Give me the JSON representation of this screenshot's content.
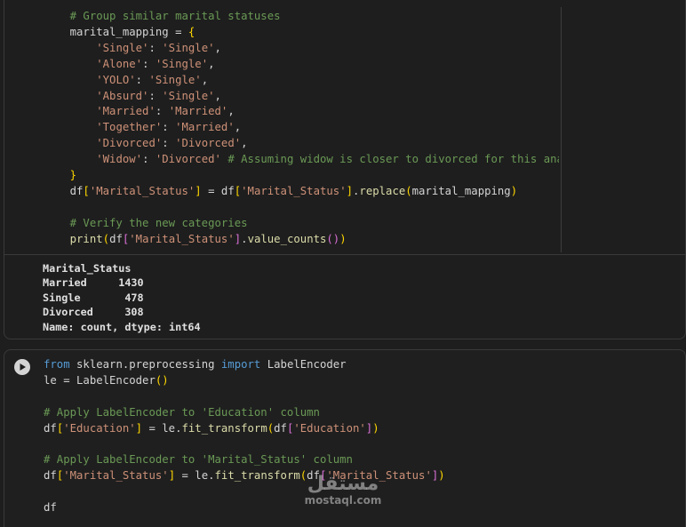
{
  "cell1": {
    "lines": [
      [
        {
          "t": "    # Group similar marital statuses",
          "c": "cm"
        }
      ],
      [
        {
          "t": "    marital_mapping = "
        },
        {
          "t": "{",
          "c": "br"
        }
      ],
      [
        {
          "t": "        "
        },
        {
          "t": "'Single'",
          "c": "st"
        },
        {
          "t": ": "
        },
        {
          "t": "'Single'",
          "c": "st"
        },
        {
          "t": ","
        }
      ],
      [
        {
          "t": "        "
        },
        {
          "t": "'Alone'",
          "c": "st"
        },
        {
          "t": ": "
        },
        {
          "t": "'Single'",
          "c": "st"
        },
        {
          "t": ","
        }
      ],
      [
        {
          "t": "        "
        },
        {
          "t": "'YOLO'",
          "c": "st"
        },
        {
          "t": ": "
        },
        {
          "t": "'Single'",
          "c": "st"
        },
        {
          "t": ","
        }
      ],
      [
        {
          "t": "        "
        },
        {
          "t": "'Absurd'",
          "c": "st"
        },
        {
          "t": ": "
        },
        {
          "t": "'Single'",
          "c": "st"
        },
        {
          "t": ","
        }
      ],
      [
        {
          "t": "        "
        },
        {
          "t": "'Married'",
          "c": "st"
        },
        {
          "t": ": "
        },
        {
          "t": "'Married'",
          "c": "st"
        },
        {
          "t": ","
        }
      ],
      [
        {
          "t": "        "
        },
        {
          "t": "'Together'",
          "c": "st"
        },
        {
          "t": ": "
        },
        {
          "t": "'Married'",
          "c": "st"
        },
        {
          "t": ","
        }
      ],
      [
        {
          "t": "        "
        },
        {
          "t": "'Divorced'",
          "c": "st"
        },
        {
          "t": ": "
        },
        {
          "t": "'Divorced'",
          "c": "st"
        },
        {
          "t": ","
        }
      ],
      [
        {
          "t": "        "
        },
        {
          "t": "'Widow'",
          "c": "st"
        },
        {
          "t": ": "
        },
        {
          "t": "'Divorced'",
          "c": "st"
        },
        {
          "t": " "
        },
        {
          "t": "# Assuming widow is closer to divorced for this analysis",
          "c": "cm"
        }
      ],
      [
        {
          "t": "    "
        },
        {
          "t": "}",
          "c": "br"
        }
      ],
      [
        {
          "t": "    df"
        },
        {
          "t": "[",
          "c": "br"
        },
        {
          "t": "'Marital_Status'",
          "c": "st"
        },
        {
          "t": "]",
          "c": "br"
        },
        {
          "t": " = df"
        },
        {
          "t": "[",
          "c": "br"
        },
        {
          "t": "'Marital_Status'",
          "c": "st"
        },
        {
          "t": "]",
          "c": "br"
        },
        {
          "t": "."
        },
        {
          "t": "replace",
          "c": "fn"
        },
        {
          "t": "(",
          "c": "br"
        },
        {
          "t": "marital_mapping"
        },
        {
          "t": ")",
          "c": "br"
        }
      ],
      [
        {
          "t": ""
        }
      ],
      [
        {
          "t": "    # Verify the new categories",
          "c": "cm"
        }
      ],
      [
        {
          "t": "    "
        },
        {
          "t": "print",
          "c": "fn"
        },
        {
          "t": "(",
          "c": "br"
        },
        {
          "t": "df"
        },
        {
          "t": "[",
          "c": "br2"
        },
        {
          "t": "'Marital_Status'",
          "c": "st"
        },
        {
          "t": "]",
          "c": "br2"
        },
        {
          "t": "."
        },
        {
          "t": "value_counts",
          "c": "fn"
        },
        {
          "t": "()",
          "c": "br2"
        },
        {
          "t": ")",
          "c": "br"
        }
      ]
    ],
    "output": "Marital_Status\nMarried     1430\nSingle       478\nDivorced     308\nName: count, dtype: int64"
  },
  "cell2": {
    "lines": [
      [
        {
          "t": "from",
          "c": "kw"
        },
        {
          "t": " sklearn.preprocessing "
        },
        {
          "t": "import",
          "c": "kw"
        },
        {
          "t": " LabelEncoder"
        }
      ],
      [
        {
          "t": "le = LabelEncoder"
        },
        {
          "t": "()",
          "c": "br"
        }
      ],
      [
        {
          "t": ""
        }
      ],
      [
        {
          "t": "# Apply LabelEncoder to 'Education' column",
          "c": "cm"
        }
      ],
      [
        {
          "t": "df"
        },
        {
          "t": "[",
          "c": "br"
        },
        {
          "t": "'Education'",
          "c": "st"
        },
        {
          "t": "]",
          "c": "br"
        },
        {
          "t": " = le."
        },
        {
          "t": "fit_transform",
          "c": "fn"
        },
        {
          "t": "(",
          "c": "br"
        },
        {
          "t": "df"
        },
        {
          "t": "[",
          "c": "br2"
        },
        {
          "t": "'Education'",
          "c": "st"
        },
        {
          "t": "]",
          "c": "br2"
        },
        {
          "t": ")",
          "c": "br"
        }
      ],
      [
        {
          "t": ""
        }
      ],
      [
        {
          "t": "# Apply LabelEncoder to 'Marital_Status' column",
          "c": "cm"
        }
      ],
      [
        {
          "t": "df"
        },
        {
          "t": "[",
          "c": "br"
        },
        {
          "t": "'Marital_Status'",
          "c": "st"
        },
        {
          "t": "]",
          "c": "br"
        },
        {
          "t": " = le."
        },
        {
          "t": "fit_transform",
          "c": "fn"
        },
        {
          "t": "(",
          "c": "br"
        },
        {
          "t": "df"
        },
        {
          "t": "[",
          "c": "br2"
        },
        {
          "t": "'Marital_Status'",
          "c": "st"
        },
        {
          "t": "]",
          "c": "br2"
        },
        {
          "t": ")",
          "c": "br"
        }
      ],
      [
        {
          "t": ""
        }
      ],
      [
        {
          "t": "df"
        }
      ]
    ],
    "run_icon": "play-icon"
  },
  "watermark": {
    "logo": "مستقل",
    "text": "mostaql.com"
  }
}
